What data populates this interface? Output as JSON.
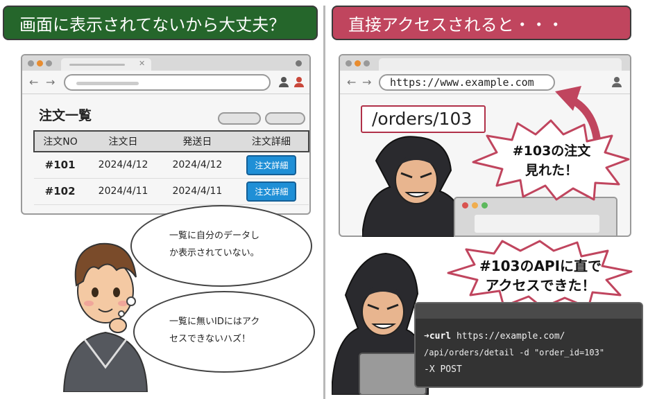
{
  "left_panel": {
    "title": "画面に表示されてないから大丈夫？",
    "page_title": "注文一覧",
    "table": {
      "headers": [
        "注文NO",
        "注文日",
        "発送日",
        "注文詳細"
      ],
      "rows": [
        {
          "no": "#101",
          "order_date": "2024/4/12",
          "ship_date": "2024/4/12",
          "button": "注文詳細"
        },
        {
          "no": "#102",
          "order_date": "2024/4/11",
          "ship_date": "2024/4/11",
          "button": "注文詳細"
        }
      ]
    },
    "thought_1": [
      "一覧に自分のデータし",
      "か表示されていない。"
    ],
    "thought_2": [
      "一覧に無いIDにはアク",
      "セスできないハズ！"
    ]
  },
  "right_panel": {
    "title": "直接アクセスされると・・・",
    "url": "https://www.example.com",
    "path": "/orders/103",
    "burst_1": [
      "#103の注文",
      "見れた！"
    ],
    "burst_2": [
      "#103のAPIに直で",
      "アクセスできた！"
    ],
    "terminal": {
      "prompt": "➜",
      "command": "curl",
      "line_1": " https://example.com/",
      "line_2": "/api/orders/detail -d \"order_id=103\"",
      "line_3": "-X POST"
    }
  },
  "colors": {
    "left_title_bg": "#25662b",
    "right_title_bg": "#c0455e",
    "detail_button": "#1f8fd6",
    "alert_red": "#c0455e"
  },
  "icons": [
    "back-arrow-icon",
    "forward-arrow-icon",
    "user-icon",
    "close-icon",
    "curved-arrow-icon"
  ]
}
